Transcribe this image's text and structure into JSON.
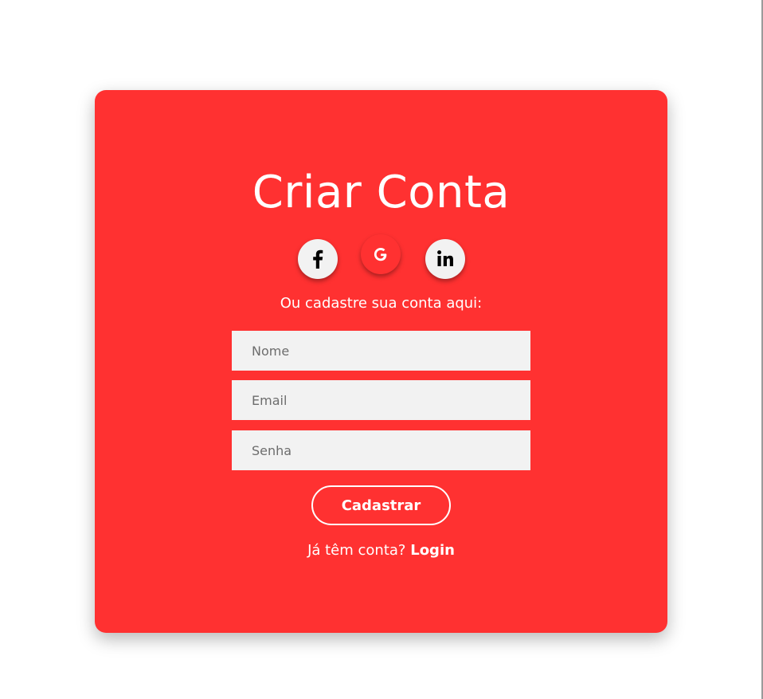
{
  "colors": {
    "card_background": "#ff3131",
    "social_light_background": "#f2f2f2",
    "field_background": "#f2f2f2",
    "icon_dark": "#000000"
  },
  "card": {
    "title": "Criar Conta",
    "social": [
      {
        "name": "facebook",
        "icon": "facebook-icon",
        "glyph": "f"
      },
      {
        "name": "google",
        "icon": "google-icon",
        "glyph": "G"
      },
      {
        "name": "linkedin",
        "icon": "linkedin-icon",
        "glyph": "in"
      }
    ],
    "subtitle": "Ou cadastre sua conta aqui:",
    "fields": {
      "name_placeholder": "Nome",
      "email_placeholder": "Email",
      "password_placeholder": "Senha"
    },
    "submit_label": "Cadastrar",
    "login_prompt": "Já têm conta?",
    "login_link": "Login"
  }
}
